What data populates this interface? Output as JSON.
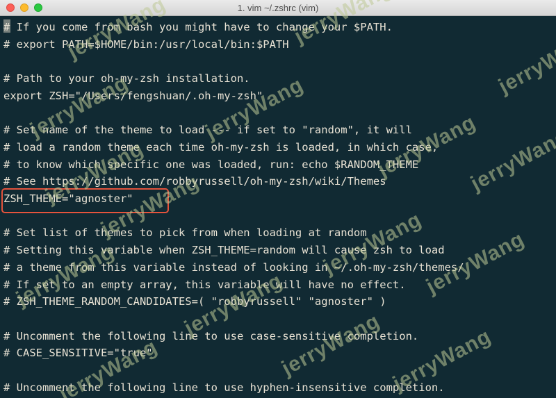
{
  "window": {
    "title": "1. vim ~/.zshrc (vim)"
  },
  "editor": {
    "lines": [
      "# If you come from bash you might have to change your $PATH.",
      "# export PATH=$HOME/bin:/usr/local/bin:$PATH",
      "",
      "# Path to your oh-my-zsh installation.",
      "export ZSH=\"/Users/fengshuan/.oh-my-zsh\"",
      "",
      "# Set name of the theme to load --- if set to \"random\", it will",
      "# load a random theme each time oh-my-zsh is loaded, in which case,",
      "# to know which specific one was loaded, run: echo $RANDOM_THEME",
      "# See https://github.com/robbyrussell/oh-my-zsh/wiki/Themes",
      "ZSH_THEME=\"agnoster\"",
      "",
      "# Set list of themes to pick from when loading at random",
      "# Setting this variable when ZSH_THEME=random will cause zsh to load",
      "# a theme from this variable instead of looking in ~/.oh-my-zsh/themes/",
      "# If set to an empty array, this variable will have no effect.",
      "# ZSH_THEME_RANDOM_CANDIDATES=( \"robbyrussell\" \"agnoster\" )",
      "",
      "# Uncomment the following line to use case-sensitive completion.",
      "# CASE_SENSITIVE=\"true\"",
      "",
      "# Uncomment the following line to use hyphen-insensitive completion."
    ]
  },
  "watermark": {
    "text": "jerryWang"
  },
  "colors": {
    "background": "#112a33",
    "text": "#e8e2d4",
    "highlight": "#e5533c",
    "watermark": "#bec896"
  }
}
